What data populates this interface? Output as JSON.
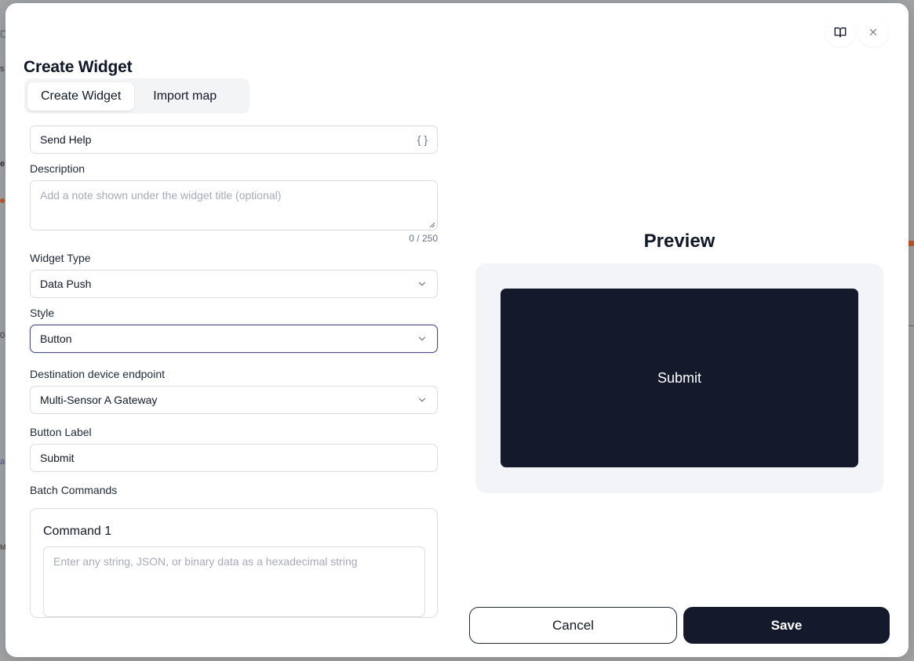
{
  "modal": {
    "title": "Create Widget",
    "tabs": [
      {
        "label": "Create Widget",
        "active": true
      },
      {
        "label": "Import map",
        "active": false
      }
    ]
  },
  "form": {
    "name": {
      "value": "Send Help",
      "variable_icon": "{ }"
    },
    "description": {
      "label": "Description",
      "placeholder": "Add a note shown under the widget title (optional)",
      "counter": "0 / 250"
    },
    "widget_type": {
      "label": "Widget Type",
      "value": "Data Push"
    },
    "style": {
      "label": "Style",
      "value": "Button"
    },
    "destination": {
      "label": "Destination device endpoint",
      "value": "Multi-Sensor A Gateway"
    },
    "button_label": {
      "label": "Button Label",
      "value": "Submit"
    },
    "batch_commands": {
      "label": "Batch Commands",
      "commands": [
        {
          "title": "Command 1",
          "placeholder": "Enter any string, JSON, or binary data as a hexadecimal string"
        }
      ]
    }
  },
  "preview": {
    "title": "Preview",
    "button_text": "Submit"
  },
  "footer": {
    "cancel_label": "Cancel",
    "save_label": "Save"
  },
  "colors": {
    "primary_dark": "#141a2b",
    "focus_border": "#4a4e8a",
    "preview_bg": "#f3f4f7"
  },
  "icons": [
    "book-open-icon",
    "close-icon",
    "chevron-down-icon"
  ]
}
